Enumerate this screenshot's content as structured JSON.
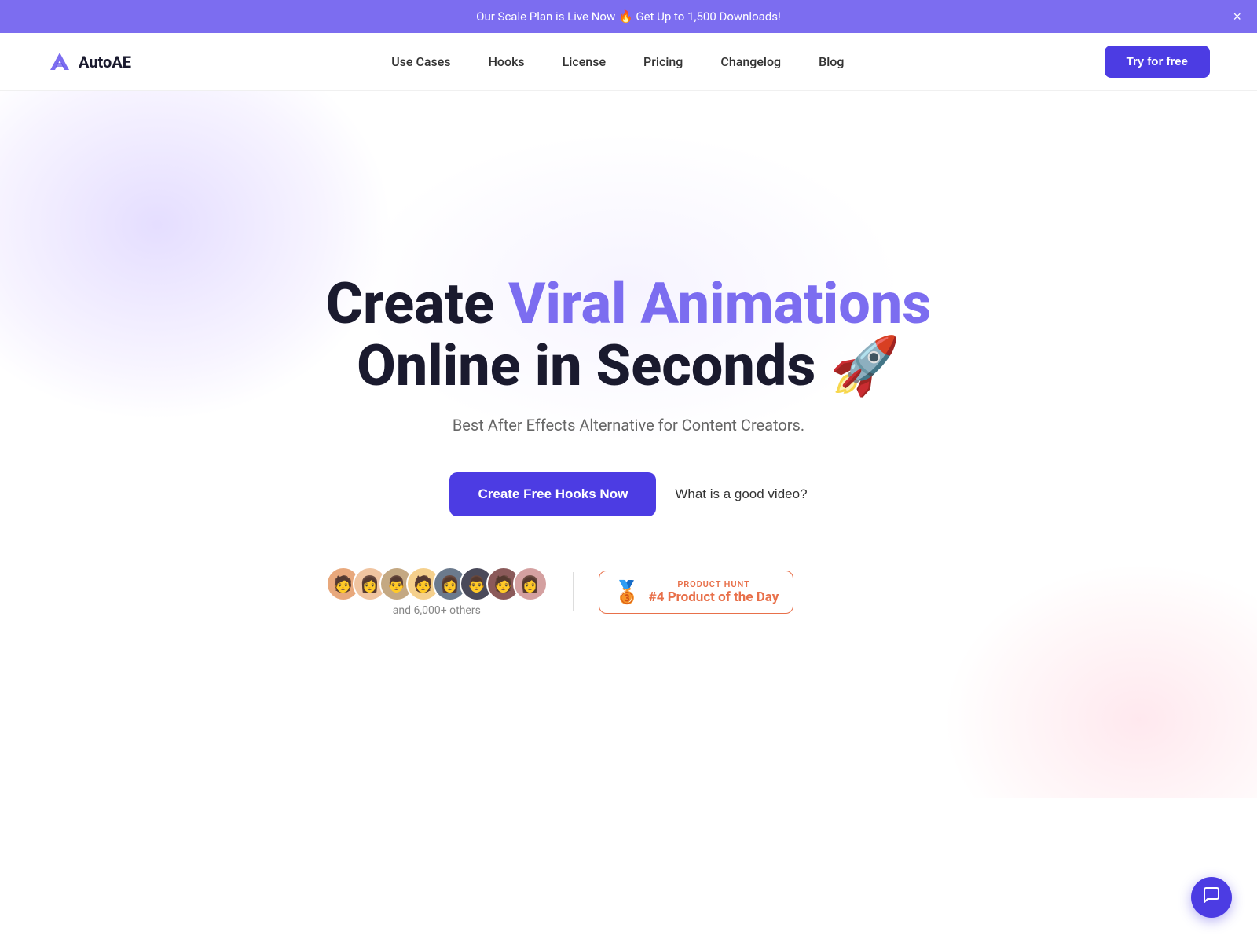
{
  "announcement": {
    "text": "Our Scale Plan is Live Now 🔥 Get Up to 1,500 Downloads!",
    "close_label": "×"
  },
  "navbar": {
    "logo_text": "AutoAE",
    "nav_items": [
      {
        "label": "Use Cases",
        "href": "#"
      },
      {
        "label": "Hooks",
        "href": "#"
      },
      {
        "label": "License",
        "href": "#"
      },
      {
        "label": "Pricing",
        "href": "#"
      },
      {
        "label": "Changelog",
        "href": "#"
      },
      {
        "label": "Blog",
        "href": "#"
      }
    ],
    "cta_label": "Try for free"
  },
  "hero": {
    "title_part1": "Create ",
    "title_highlight": "Viral Animations",
    "title_part2": "Online in Seconds 🚀",
    "subtitle": "Best After Effects Alternative for Content Creators.",
    "cta_primary": "Create Free Hooks Now",
    "cta_secondary": "What is a good video?",
    "avatars": [
      "🧑",
      "👩",
      "👨",
      "🧑",
      "👩",
      "👨",
      "🧑",
      "👩"
    ],
    "avatar_count_text": "and 6,000+ others",
    "ph_label": "PRODUCT HUNT",
    "ph_rank": "#4 Product of the Day"
  },
  "chat": {
    "icon": "💬"
  }
}
